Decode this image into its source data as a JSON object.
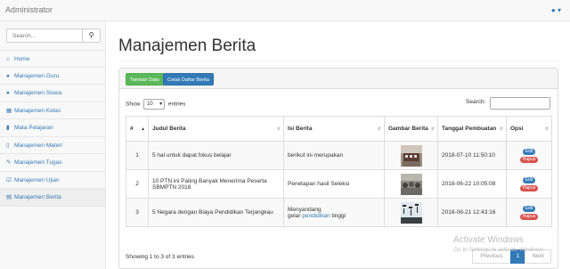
{
  "app": {
    "brand": "Administrator"
  },
  "sidebar": {
    "search_placeholder": "Search...",
    "items": [
      {
        "label": "Home",
        "icon": "home-icon"
      },
      {
        "label": "Manajemen Guru",
        "icon": "users-icon"
      },
      {
        "label": "Manajemen Siswa",
        "icon": "users-icon"
      },
      {
        "label": "Manajemen Kelas",
        "icon": "grid-icon"
      },
      {
        "label": "Mata Pelajaran",
        "icon": "book-icon"
      },
      {
        "label": "Manajemen Materi",
        "icon": "file-icon"
      },
      {
        "label": "Manajemen Tugas",
        "icon": "pencil-icon"
      },
      {
        "label": "Manajemen Ujian",
        "icon": "edit-icon"
      },
      {
        "label": "Manajemen Berita",
        "icon": "newspaper-icon"
      }
    ]
  },
  "main": {
    "title": "Manajemen Berita",
    "buttons": {
      "add": "Tambah Data",
      "print": "Cetak Daftar Berita"
    },
    "show_label_pre": "Show",
    "show_value": "10",
    "show_label_post": "entries",
    "search_label": "Search:",
    "columns": [
      "#",
      "Judul Berita",
      "Isi Berita",
      "Gambar Berita",
      "Tanggal Pembuatan",
      "Opsi"
    ],
    "rows": [
      {
        "no": "1",
        "judul": "5 hal untuk dapat fokus belajar",
        "isi": "berikut ini merupakan",
        "tanggal": "2018-07-10 11:50:10",
        "edit": "Edit",
        "hapus": "Hapus"
      },
      {
        "no": "2",
        "judul": "10 PTN ini Paling Banyak Menerima Peserta SBMPTN 2018",
        "isi": "Penetapan hasil Seleksi",
        "tanggal": "2018-06-22 10:05:08",
        "edit": "Edit",
        "hapus": "Hapus"
      },
      {
        "no": "3",
        "judul": "5 Negara dengan Biaya Pendidikan Terjangkau",
        "isi_a": "Menyandang",
        "isi_b": "gelar",
        "isi_link": "pendidikan",
        "isi_c": "tinggi",
        "tanggal": "2018-06-21 12:43:16",
        "edit": "Edit",
        "hapus": "Hapus"
      }
    ],
    "info": "Showing 1 to 3 of 3 entries",
    "pagination": {
      "prev": "Previous",
      "current": "1",
      "next": "Next"
    }
  },
  "watermark": {
    "line1": "Activate Windows",
    "line2": "Go to Settings to activate Windows."
  },
  "colors": {
    "primary": "#337ab7",
    "success": "#5cb85c",
    "danger": "#d9534f"
  }
}
